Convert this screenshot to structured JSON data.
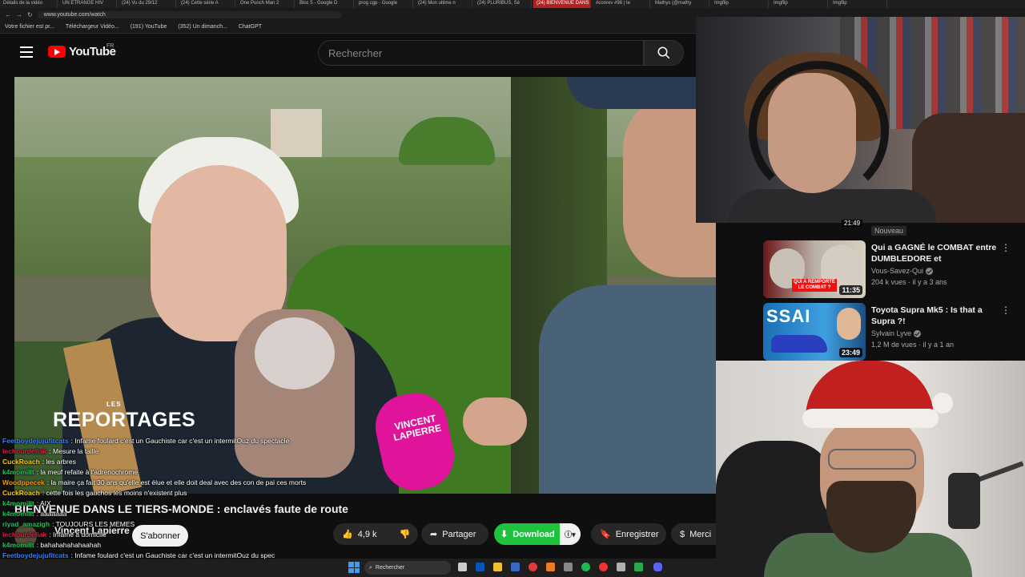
{
  "browser": {
    "tabs": [
      "Détails de la vidéo",
      "UN ETRANGE HIV",
      "(24) Vu du 29/12",
      "(24) Cette série A",
      "One Punch Man 2",
      "Bloc 5 - Google D",
      "prog cgp - Google",
      "(24) Mon ultime n",
      "(24) PLURIBUS, Sé",
      "(24) BIENVENUE DANS L",
      "#conrev #98 | te",
      "Mathys (@mathy",
      "Imgflip",
      "Imgflip",
      "Imgflip"
    ],
    "active_tab": "(24) BIENVENUE DANS L",
    "url": "www.youtube.com/watch",
    "bookmarks": [
      "Votre fichier est pr...",
      "Téléchargeur Vidéo...",
      "(191) YouTube",
      "(352) Un dimanch...",
      "ChatGPT"
    ]
  },
  "youtube": {
    "logo_text": "YouTube",
    "region": "FR",
    "search_placeholder": "Rechercher"
  },
  "video": {
    "brand_small": "LES",
    "brand_large": "REPORTAGES",
    "mic_text": "VINCENT LAPIERRE",
    "title": "BIENVENUE DANS LE TIERS-MONDE : enclavés faute de route",
    "channel": "Vincent Lapierre",
    "subscribers": "",
    "subscribe_label": "S'abonner",
    "likes": "4,9 k",
    "share_label": "Partager",
    "download_label": "Download",
    "save_label": "Enregistrer",
    "thanks_label": "Merci"
  },
  "chat": [
    {
      "user": "Feetboydejujufitcats",
      "user_color": "#3b82f6",
      "text": "Infame foulard c'est un Gauchiste car c'est un intermitOuz du spectacle"
    },
    {
      "user": "lechourdefiak",
      "user_color": "#e11d48",
      "text": "Mesure la taille"
    },
    {
      "user": "CuckRoach",
      "user_color": "#facc15",
      "text": "les arbres"
    },
    {
      "user": "k4momillt",
      "user_color": "#22c55e",
      "text": "la meuf refaite à l'adrenochrome"
    },
    {
      "user": "Woodppecek",
      "user_color": "#f59e0b",
      "text": "la maire ça fait 30 ans qu'elle est élue et elle doit deal avec des con de pai ces morts"
    },
    {
      "user": "CuckRoach",
      "user_color": "#facc15",
      "text": "cette fois les gauchos les moins n'existent plus"
    },
    {
      "user": "k4momillt",
      "user_color": "#22c55e",
      "text": "AIX"
    },
    {
      "user": "k4momillt",
      "user_color": "#22c55e",
      "text": "aaaaaaa"
    },
    {
      "user": "riyad_amazigh",
      "user_color": "#22c55e",
      "text": "TOUJOURS LES MEMES"
    },
    {
      "user": "lechourdefiak",
      "user_color": "#e11d48",
      "text": "Infame a domicile"
    },
    {
      "user": "k4momillt",
      "user_color": "#22c55e",
      "text": "bahahahahahaahah"
    },
    {
      "user": "Feetboydejujufitcats",
      "user_color": "#3b82f6",
      "text": "Infame foulard c'est un Gauchiste car c'est un intermitOuz du spec"
    }
  ],
  "sidebar": {
    "top_duration": "21:49",
    "new_badge": "Nouveau",
    "recommendations": [
      {
        "title": "Qui a GAGNÉ le COMBAT entre DUMBLEDORE et VOLDEMORT...",
        "channel": "Vous-Savez-Qui",
        "meta": "204 k vues · il y a 3 ans",
        "duration": "11:35",
        "thumb_text": "QUI A REMPORTÉ LE COMBAT ?"
      },
      {
        "title": "Toyota Supra Mk5 : Is that a Supra ?!",
        "channel": "Sylvain Lyve",
        "meta": "1,2 M de vues · il y a 1 an",
        "duration": "23:49",
        "thumb_text": "SSAI"
      }
    ]
  },
  "taskbar": {
    "search_label": "Rechercher"
  },
  "colors": {
    "youtube_red": "#ff0000",
    "download_green": "#1ec23c",
    "background": "#0f0f0f"
  }
}
